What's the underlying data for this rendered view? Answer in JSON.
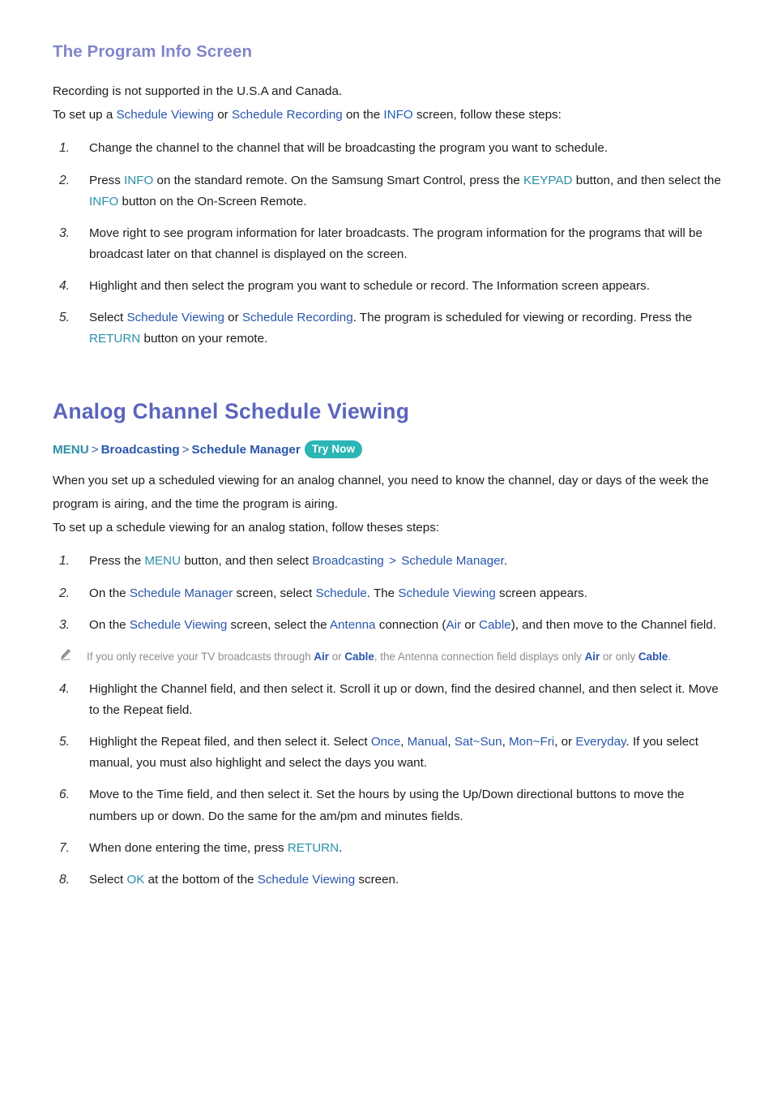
{
  "document": {
    "sub_heading": "The Program Info Screen",
    "main_heading": "Analog Channel Schedule Viewing"
  },
  "intro": {
    "line1": "Recording is not supported in the U.S.A and Canada.",
    "line2_a": "To set up a ",
    "line2_schedule_viewing": "Schedule Viewing",
    "line2_b": " or ",
    "line2_schedule_recording": "Schedule Recording",
    "line2_c": " on the ",
    "line2_info": "INFO",
    "line2_d": " screen, follow these steps:"
  },
  "steps_info": [
    {
      "num": "1.",
      "parts": [
        {
          "text": "Change the channel to the channel that will be broadcasting the program you want to schedule.",
          "style": "plain"
        }
      ]
    },
    {
      "num": "2.",
      "parts": [
        {
          "text": "Press ",
          "style": "plain"
        },
        {
          "text": "INFO",
          "style": "teal"
        },
        {
          "text": " on the standard remote. On the Samsung Smart Control, press the ",
          "style": "plain"
        },
        {
          "text": "KEYPAD",
          "style": "teal"
        },
        {
          "text": " button, and then select the ",
          "style": "plain"
        },
        {
          "text": "INFO",
          "style": "teal"
        },
        {
          "text": " button on the On-Screen Remote.",
          "style": "plain"
        }
      ]
    },
    {
      "num": "3.",
      "parts": [
        {
          "text": "Move right to see program information for later broadcasts. The program information for the programs that will be broadcast later on that channel is displayed on the screen.",
          "style": "plain"
        }
      ]
    },
    {
      "num": "4.",
      "parts": [
        {
          "text": "Highlight and then select the program you want to schedule or record. The Information screen appears.",
          "style": "plain"
        }
      ]
    },
    {
      "num": "5.",
      "parts": [
        {
          "text": "Select ",
          "style": "plain"
        },
        {
          "text": "Schedule Viewing",
          "style": "blue"
        },
        {
          "text": " or ",
          "style": "plain"
        },
        {
          "text": "Schedule Recording",
          "style": "blue"
        },
        {
          "text": ". The program is scheduled for viewing or recording. Press the ",
          "style": "plain"
        },
        {
          "text": "RETURN",
          "style": "teal"
        },
        {
          "text": " button on your remote.",
          "style": "plain"
        }
      ]
    }
  ],
  "breadcrumb": {
    "menu": "MENU",
    "sep1": ">",
    "broadcasting": "Broadcasting",
    "sep2": ">",
    "schedule_manager": "Schedule Manager",
    "badge": "Try Now"
  },
  "analog": {
    "para1": "When you set up a scheduled viewing for an analog channel, you need to know the channel, day or days of the week the program is airing, and the time the program is airing.",
    "para2": "To set up a schedule viewing for an analog station, follow theses steps:"
  },
  "steps_analog": [
    {
      "num": "1.",
      "parts": [
        {
          "text": "Press the ",
          "style": "plain"
        },
        {
          "text": "MENU",
          "style": "teal"
        },
        {
          "text": " button, and then select ",
          "style": "plain"
        },
        {
          "text": "Broadcasting",
          "style": "blue"
        },
        {
          "text": " > ",
          "style": "gt"
        },
        {
          "text": "Schedule Manager",
          "style": "blue"
        },
        {
          "text": ".",
          "style": "plain"
        }
      ]
    },
    {
      "num": "2.",
      "parts": [
        {
          "text": "On the ",
          "style": "plain"
        },
        {
          "text": "Schedule Manager",
          "style": "blue"
        },
        {
          "text": " screen, select ",
          "style": "plain"
        },
        {
          "text": "Schedule",
          "style": "blue"
        },
        {
          "text": ". The ",
          "style": "plain"
        },
        {
          "text": "Schedule Viewing",
          "style": "blue"
        },
        {
          "text": " screen appears.",
          "style": "plain"
        }
      ]
    },
    {
      "num": "3.",
      "parts": [
        {
          "text": "On the ",
          "style": "plain"
        },
        {
          "text": "Schedule Viewing",
          "style": "blue"
        },
        {
          "text": " screen, select the ",
          "style": "plain"
        },
        {
          "text": "Antenna",
          "style": "blue"
        },
        {
          "text": " connection (",
          "style": "plain"
        },
        {
          "text": "Air",
          "style": "blue"
        },
        {
          "text": " or ",
          "style": "plain"
        },
        {
          "text": "Cable",
          "style": "blue"
        },
        {
          "text": "), and then move to the Channel field.",
          "style": "plain"
        }
      ]
    },
    {
      "num": "4.",
      "parts": [
        {
          "text": "Highlight the Channel field, and then select it. Scroll it up or down, find the desired channel, and then select it. Move to the Repeat field.",
          "style": "plain"
        }
      ]
    },
    {
      "num": "5.",
      "parts": [
        {
          "text": "Highlight the Repeat filed, and then select it. Select ",
          "style": "plain"
        },
        {
          "text": "Once",
          "style": "blue"
        },
        {
          "text": ", ",
          "style": "plain"
        },
        {
          "text": "Manual",
          "style": "blue"
        },
        {
          "text": ", ",
          "style": "plain"
        },
        {
          "text": "Sat~Sun",
          "style": "blue"
        },
        {
          "text": ", ",
          "style": "plain"
        },
        {
          "text": "Mon~Fri",
          "style": "blue"
        },
        {
          "text": ", or ",
          "style": "plain"
        },
        {
          "text": "Everyday",
          "style": "blue"
        },
        {
          "text": ". If you select manual, you must also highlight and select the days you want.",
          "style": "plain"
        }
      ]
    },
    {
      "num": "6.",
      "parts": [
        {
          "text": "Move to the Time field, and then select it. Set the hours by using the Up/Down directional buttons to move the numbers up or down. Do the same for the am/pm and minutes fields.",
          "style": "plain"
        }
      ]
    },
    {
      "num": "7.",
      "parts": [
        {
          "text": "When done entering the time, press ",
          "style": "plain"
        },
        {
          "text": "RETURN",
          "style": "teal"
        },
        {
          "text": ".",
          "style": "plain"
        }
      ]
    },
    {
      "num": "8.",
      "parts": [
        {
          "text": "Select ",
          "style": "plain"
        },
        {
          "text": "OK",
          "style": "teal"
        },
        {
          "text": " at the bottom of the ",
          "style": "plain"
        },
        {
          "text": "Schedule Viewing",
          "style": "blue"
        },
        {
          "text": " screen.",
          "style": "plain"
        }
      ]
    }
  ],
  "note": {
    "icon": "pencil-icon",
    "parts": [
      {
        "text": "If you only receive your TV broadcasts through ",
        "style": "plain"
      },
      {
        "text": "Air",
        "style": "bold-blue"
      },
      {
        "text": " or ",
        "style": "plain"
      },
      {
        "text": "Cable",
        "style": "bold-blue"
      },
      {
        "text": ", the Antenna connection field displays only ",
        "style": "plain"
      },
      {
        "text": "Air",
        "style": "bold-blue"
      },
      {
        "text": " or only ",
        "style": "plain"
      },
      {
        "text": "Cable",
        "style": "bold-blue"
      },
      {
        "text": ".",
        "style": "plain"
      }
    ]
  },
  "colors": {
    "sub_heading": "#8086c8",
    "main_heading": "#5b65bd",
    "keyword_blue": "#2a56ab",
    "keyword_teal": "#2b8fa8",
    "badge_bg": "#2bb5b5",
    "note_text": "#8d8d8d",
    "body_text": "#1c1c1c"
  }
}
